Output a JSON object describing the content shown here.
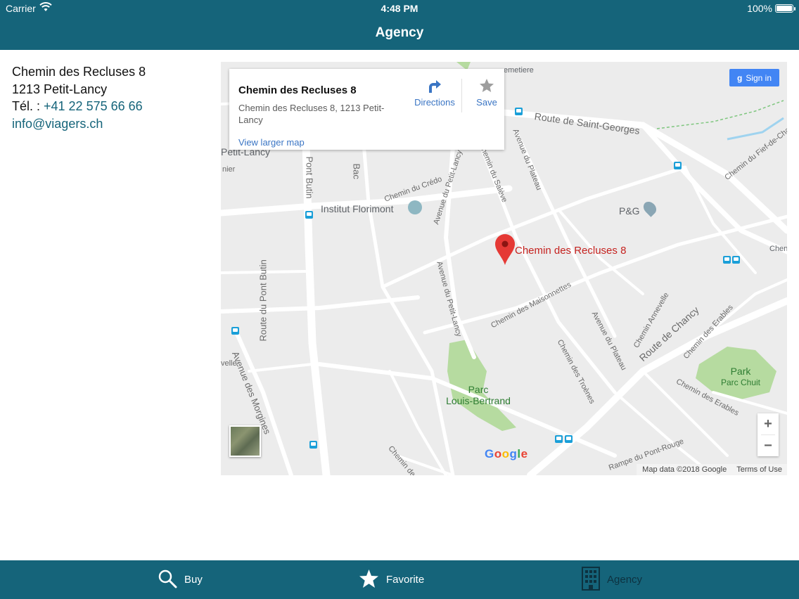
{
  "status_bar": {
    "carrier": "Carrier",
    "time": "4:48 PM",
    "battery": "100%"
  },
  "header": {
    "title": "Agency"
  },
  "agency": {
    "street": "Chemin des Recluses 8",
    "city": "1213 Petit-Lancy",
    "phone_prefix": "Tél. : ",
    "phone": "+41 22 575 66 66",
    "email": "info@viagers.ch"
  },
  "map": {
    "card": {
      "name": "Chemin des Recluses 8",
      "address": "Chemin des Recluses 8, 1213 Petit-Lancy",
      "view_larger": "View larger map",
      "directions": "Directions",
      "save": "Save"
    },
    "sign_in": "Sign in",
    "pin_label": "Chemin des Recluses 8",
    "pois": {
      "institut": "Institut Florimont",
      "pg": "P&G",
      "petit_lancy": "Petit-Lancy",
      "cemetery": "emetiere",
      "chen": "Chen"
    },
    "parks": {
      "louis_bertrand_1": "Parc",
      "louis_bertrand_2": "Louis-Bertrand",
      "chuit_1": "Park",
      "chuit_2": "Parc Chuit"
    },
    "streets": {
      "saint_georges": "Route de Saint-Georges",
      "fief": "Chemin du Fief-de-Chap",
      "pont_butin": "Pont Butin",
      "route_pont_butin": "Route du Pont Butin",
      "bac": "Bac",
      "credo": "Chemin du Crédo",
      "petit_lancy_1": "Avenue du Petit-Lancy",
      "petit_lancy_2": "Avenue du Petit-Lancy",
      "salève": "Chemin du Salève",
      "plateau_1": "Avenue du Plateau",
      "plateau_2": "Avenue du Plateau",
      "maisonnettes": "Chemin des Maisonnettes",
      "troenes": "Chemin des Troènes",
      "annevelle": "Chemin Annevelle",
      "chancy": "Route de Chancy",
      "erables_1": "Chemin des Erables",
      "erables_2": "Chemin des Erables",
      "morgines": "Avenue des Morgines",
      "des": "Chemin des",
      "pont_rouge": "Rampe du Pont-Rouge",
      "velle": "velle",
      "nier": "nier"
    },
    "zoom_in": "+",
    "zoom_out": "−",
    "google": "Google",
    "map_data": "Map data ©2018 Google",
    "terms": "Terms of Use"
  },
  "tabs": [
    {
      "label": "Buy",
      "icon": "search-icon"
    },
    {
      "label": "Favorite",
      "icon": "star-icon"
    },
    {
      "label": "Agency",
      "icon": "building-icon"
    }
  ],
  "colors": {
    "brand": "#15647a",
    "link": "#3a75c4",
    "pin": "#c5221f",
    "park": "#b6dba0"
  }
}
